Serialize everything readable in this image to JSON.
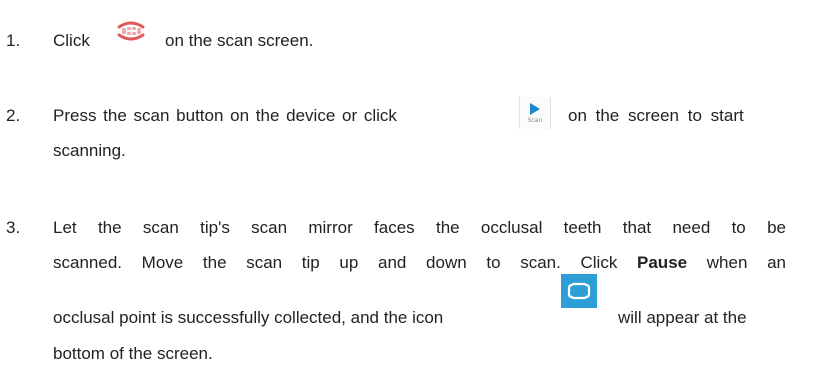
{
  "steps": [
    {
      "number": "1.",
      "text_before": "Click",
      "icon": "teeth-icon",
      "text_after": "on the scan screen."
    },
    {
      "number": "2.",
      "line1_before": "Press the scan button on the device or click",
      "icon": "scan-play-icon",
      "icon_caption": "Scan",
      "line1_after": "on the screen to start",
      "line2": "scanning."
    },
    {
      "number": "3.",
      "line1": "Let the scan tip's scan mirror faces the occlusal teeth that need to be",
      "line2_before": "scanned.  Move the scan tip up and down to scan. Click ",
      "line2_bold": "Pause",
      "line2_after": " when an",
      "line3_before": "occlusal point is successfully collected, and the icon",
      "icon": "occlusal-point-icon",
      "line3_after": "will appear at the",
      "line4": "bottom of the screen."
    }
  ],
  "colors": {
    "text": "#222222",
    "teeth_icon": "#e05a5a",
    "scan_icon": "#1f86d2",
    "occlusal_icon_bg": "#2e9fd6"
  }
}
